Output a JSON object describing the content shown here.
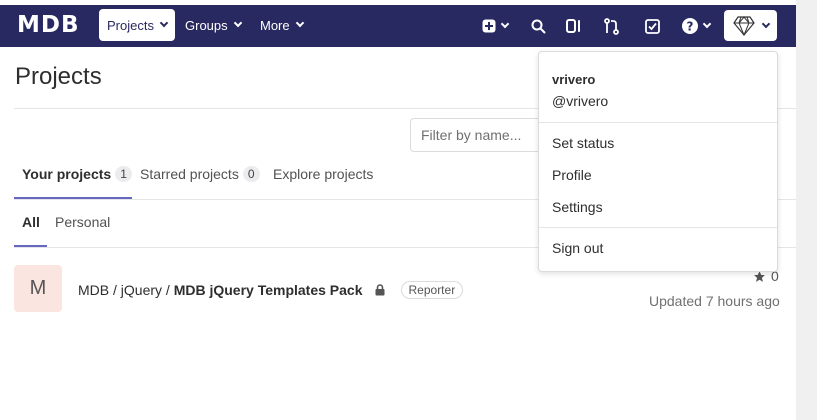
{
  "navbar": {
    "logo": "MDB",
    "projects_label": "Projects",
    "groups_label": "Groups",
    "more_label": "More"
  },
  "page": {
    "title": "Projects"
  },
  "filter": {
    "placeholder": "Filter by name..."
  },
  "tabs": [
    {
      "label": "Your projects",
      "count": "1"
    },
    {
      "label": "Starred projects",
      "count": "0"
    },
    {
      "label": "Explore projects"
    }
  ],
  "subtabs": [
    {
      "label": "All"
    },
    {
      "label": "Personal"
    }
  ],
  "project": {
    "avatar_letter": "M",
    "namespace": "MDB / jQuery / ",
    "name": "MDB jQuery Templates Pack",
    "role": "Reporter",
    "stars": "0",
    "updated": "Updated 7 hours ago"
  },
  "user_menu": {
    "name": "vrivero",
    "handle": "@vrivero",
    "items": [
      "Set status",
      "Profile",
      "Settings"
    ],
    "sign_out": "Sign out"
  },
  "colors": {
    "navbar": "#292961",
    "active_tab_underline": "#6666c4",
    "project_avatar_bg": "#fbe5e1"
  }
}
